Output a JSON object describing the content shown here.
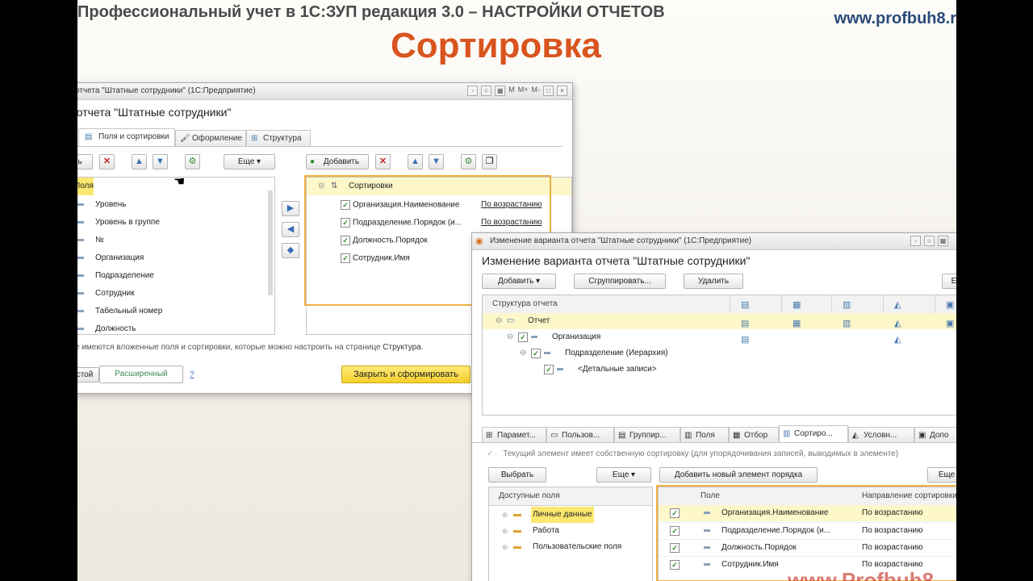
{
  "slide": {
    "title": "Профессиональный учет в 1С:ЗУП редакция 3.0 – НАСТРОЙКИ ОТЧЕТОВ",
    "site": "www.profbuh8.r",
    "main": "Сортировка",
    "watermark": "www.Profbuh8"
  },
  "back": {
    "titlebar": "отчета \"Штатные сотрудники\"  (1С:Предприятие)",
    "heading": "и отчета \"Штатные сотрудники\"",
    "window_buttons": [
      "M",
      "M+",
      "M-"
    ],
    "tabs": [
      "Поля и сортировки",
      "Оформление",
      "Структура"
    ],
    "more_label": "Еще",
    "add_label": "Добавить",
    "left_header": "Поля",
    "fields": [
      "Уровень",
      "Уровень в группе",
      "№",
      "Организация",
      "Подразделение",
      "Сотрудник",
      "Табельный номер",
      "Должность"
    ],
    "sort_header": "Сортировки",
    "sorts": [
      {
        "name": "Организация.Наименование",
        "dir": "По возрастанию"
      },
      {
        "name": "Подразделение.Порядок (и...",
        "dir": "По возрастанию"
      },
      {
        "name": "Должность.Порядок",
        "dir": ""
      },
      {
        "name": "Сотрудник.Имя",
        "dir": ""
      }
    ],
    "hint_text": "е имеются вложенные поля и сортировки, которые можно настроить на странице ",
    "hint_link": "Структура",
    "hint_dot": ".",
    "mode_simple": "стой",
    "mode_extended": "Расширенный",
    "help": "?",
    "close_button": "Закрыть и сформировать"
  },
  "front": {
    "titlebar": "Изменение варианта отчета \"Штатные сотрудники\"  (1С:Предприятие)",
    "heading": "Изменение варианта отчета \"Штатные сотрудники\"",
    "add_button": "Добавить",
    "group_button": "Сгруппировать...",
    "delete_button": "Удалить",
    "edge_button": "Е",
    "structure_header": "Структура отчета",
    "tree": [
      {
        "label": "Отчет",
        "level": 0
      },
      {
        "label": "Организация",
        "level": 1
      },
      {
        "label": "Подразделение (Иерархия)",
        "level": 2
      },
      {
        "label": "<Детальные записи>",
        "level": 3
      }
    ],
    "tabs": [
      "Парамет...",
      "Пользов...",
      "Группир...",
      "Поля",
      "Отбор",
      "Сортиро...",
      "Условн...",
      "Допо"
    ],
    "own_sort_text": "Текущий элемент имеет собственную сортировку (для  упорядочивания записей, выводимых в элементе)",
    "choose_button": "Выбрать",
    "more_button": "Еще",
    "add_order_button": "Добавить новый элемент порядка",
    "more_button2": "Еще",
    "available_header": "Доступные поля",
    "available": [
      "Личные данные",
      "Работа",
      "Пользовательские поля"
    ],
    "col_field": "Поле",
    "col_direction": "Направление сортировки",
    "order_rows": [
      {
        "field": "Организация.Наименование",
        "direction": "По возрастанию"
      },
      {
        "field": "Подразделение.Порядок (и...",
        "direction": "По возрастанию"
      },
      {
        "field": "Должность.Порядок",
        "direction": "По возрастанию"
      },
      {
        "field": "Сотрудник.Имя",
        "direction": "По возрастанию"
      }
    ]
  },
  "colors": {
    "accent_orange": "#d9541e",
    "highlight_yellow": "#fdf7c9",
    "frame_orange": "#f0b040",
    "button_yellow": "#f5cf2a"
  }
}
